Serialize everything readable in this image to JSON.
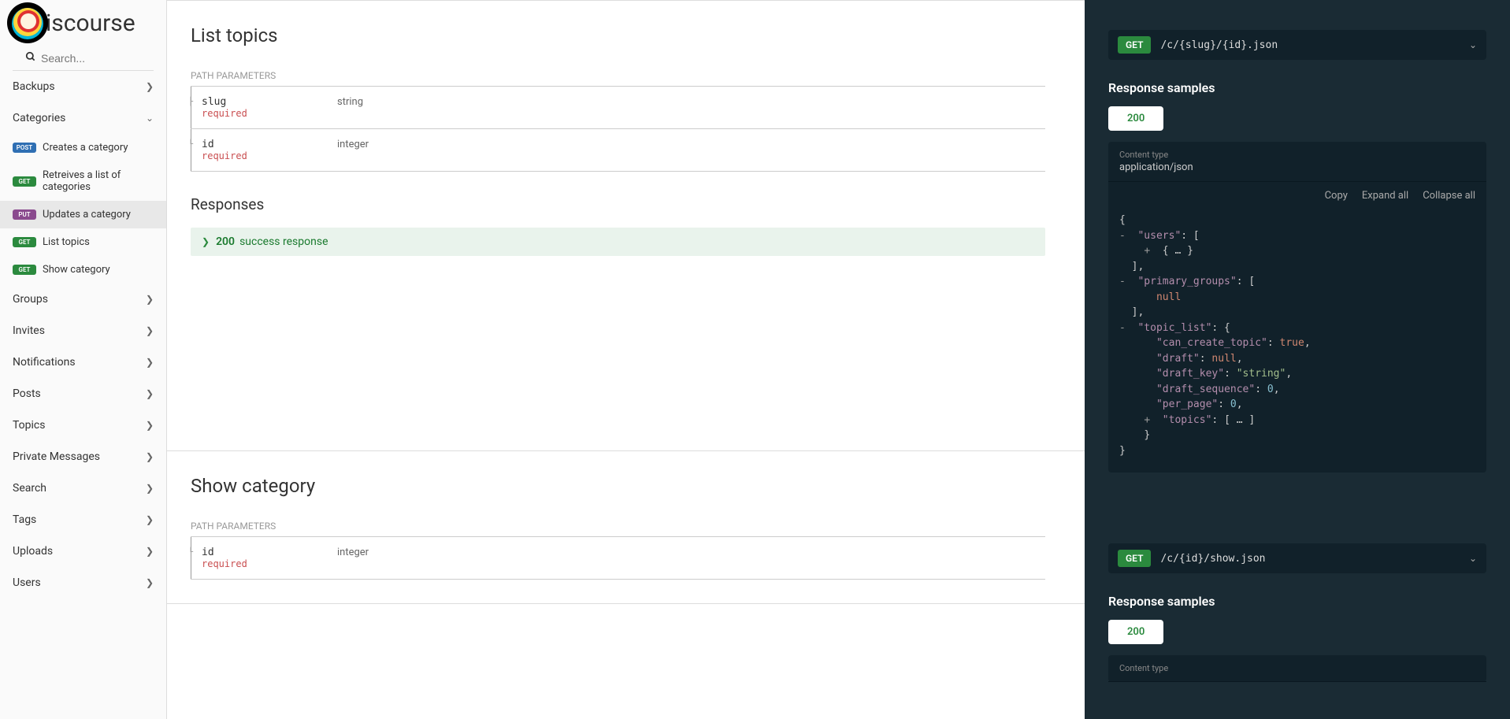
{
  "brand": "iscourse",
  "search": {
    "placeholder": "Search..."
  },
  "nav": [
    {
      "label": "Backups",
      "expanded": false
    },
    {
      "label": "Categories",
      "expanded": true,
      "children": [
        {
          "method": "POST",
          "label": "Creates a category"
        },
        {
          "method": "GET",
          "label": "Retreives a list of categories"
        },
        {
          "method": "PUT",
          "label": "Updates a category",
          "active": true
        },
        {
          "method": "GET",
          "label": "List topics"
        },
        {
          "method": "GET",
          "label": "Show category"
        }
      ]
    },
    {
      "label": "Groups"
    },
    {
      "label": "Invites"
    },
    {
      "label": "Notifications"
    },
    {
      "label": "Posts"
    },
    {
      "label": "Topics"
    },
    {
      "label": "Private Messages"
    },
    {
      "label": "Search"
    },
    {
      "label": "Tags"
    },
    {
      "label": "Uploads"
    },
    {
      "label": "Users"
    }
  ],
  "sections": [
    {
      "title": "List topics",
      "path_params_label": "PATH PARAMETERS",
      "params": [
        {
          "name": "slug",
          "required": "required",
          "type": "string"
        },
        {
          "name": "id",
          "required": "required",
          "type": "integer"
        }
      ],
      "responses_label": "Responses",
      "responses": [
        {
          "code": "200",
          "text": "success response"
        }
      ]
    },
    {
      "title": "Show category",
      "path_params_label": "PATH PARAMETERS",
      "params": [
        {
          "name": "id",
          "required": "required",
          "type": "integer"
        }
      ]
    }
  ],
  "right": {
    "blocks": [
      {
        "method": "GET",
        "path": "/c/{slug}/{id}.json",
        "samples_label": "Response samples",
        "status_tab": "200",
        "content_type_label": "Content type",
        "content_type": "application/json",
        "actions": {
          "copy": "Copy",
          "expand": "Expand all",
          "collapse": "Collapse all"
        },
        "json_lines": [
          {
            "indent": 0,
            "text": "{"
          },
          {
            "indent": 0,
            "toggle": "-",
            "frags": [
              {
                "t": "key",
                "v": "\"users\""
              },
              {
                "t": "p",
                "v": ": ["
              }
            ]
          },
          {
            "indent": 2,
            "toggle": "+",
            "frags": [
              {
                "t": "p",
                "v": "{ … }"
              }
            ]
          },
          {
            "indent": 1,
            "frags": [
              {
                "t": "p",
                "v": "],"
              }
            ]
          },
          {
            "indent": 0,
            "toggle": "-",
            "frags": [
              {
                "t": "key",
                "v": "\"primary_groups\""
              },
              {
                "t": "p",
                "v": ": ["
              }
            ]
          },
          {
            "indent": 3,
            "frags": [
              {
                "t": "null",
                "v": "null"
              }
            ]
          },
          {
            "indent": 1,
            "frags": [
              {
                "t": "p",
                "v": "],"
              }
            ]
          },
          {
            "indent": 0,
            "toggle": "-",
            "frags": [
              {
                "t": "key",
                "v": "\"topic_list\""
              },
              {
                "t": "p",
                "v": ": {"
              }
            ]
          },
          {
            "indent": 3,
            "frags": [
              {
                "t": "key",
                "v": "\"can_create_topic\""
              },
              {
                "t": "p",
                "v": ": "
              },
              {
                "t": "true",
                "v": "true"
              },
              {
                "t": "p",
                "v": ","
              }
            ]
          },
          {
            "indent": 3,
            "frags": [
              {
                "t": "key",
                "v": "\"draft\""
              },
              {
                "t": "p",
                "v": ": "
              },
              {
                "t": "null",
                "v": "null"
              },
              {
                "t": "p",
                "v": ","
              }
            ]
          },
          {
            "indent": 3,
            "frags": [
              {
                "t": "key",
                "v": "\"draft_key\""
              },
              {
                "t": "p",
                "v": ": "
              },
              {
                "t": "str",
                "v": "\"string\""
              },
              {
                "t": "p",
                "v": ","
              }
            ]
          },
          {
            "indent": 3,
            "frags": [
              {
                "t": "key",
                "v": "\"draft_sequence\""
              },
              {
                "t": "p",
                "v": ": "
              },
              {
                "t": "num",
                "v": "0"
              },
              {
                "t": "p",
                "v": ","
              }
            ]
          },
          {
            "indent": 3,
            "frags": [
              {
                "t": "key",
                "v": "\"per_page\""
              },
              {
                "t": "p",
                "v": ": "
              },
              {
                "t": "num",
                "v": "0"
              },
              {
                "t": "p",
                "v": ","
              }
            ]
          },
          {
            "indent": 2,
            "toggle": "+",
            "frags": [
              {
                "t": "key",
                "v": "\"topics\""
              },
              {
                "t": "p",
                "v": ": [ … ]"
              }
            ]
          },
          {
            "indent": 2,
            "frags": [
              {
                "t": "p",
                "v": "}"
              }
            ]
          },
          {
            "indent": 0,
            "text": "}"
          }
        ]
      },
      {
        "method": "GET",
        "path": "/c/{id}/show.json",
        "samples_label": "Response samples",
        "status_tab": "200",
        "content_type_label": "Content type"
      }
    ]
  }
}
